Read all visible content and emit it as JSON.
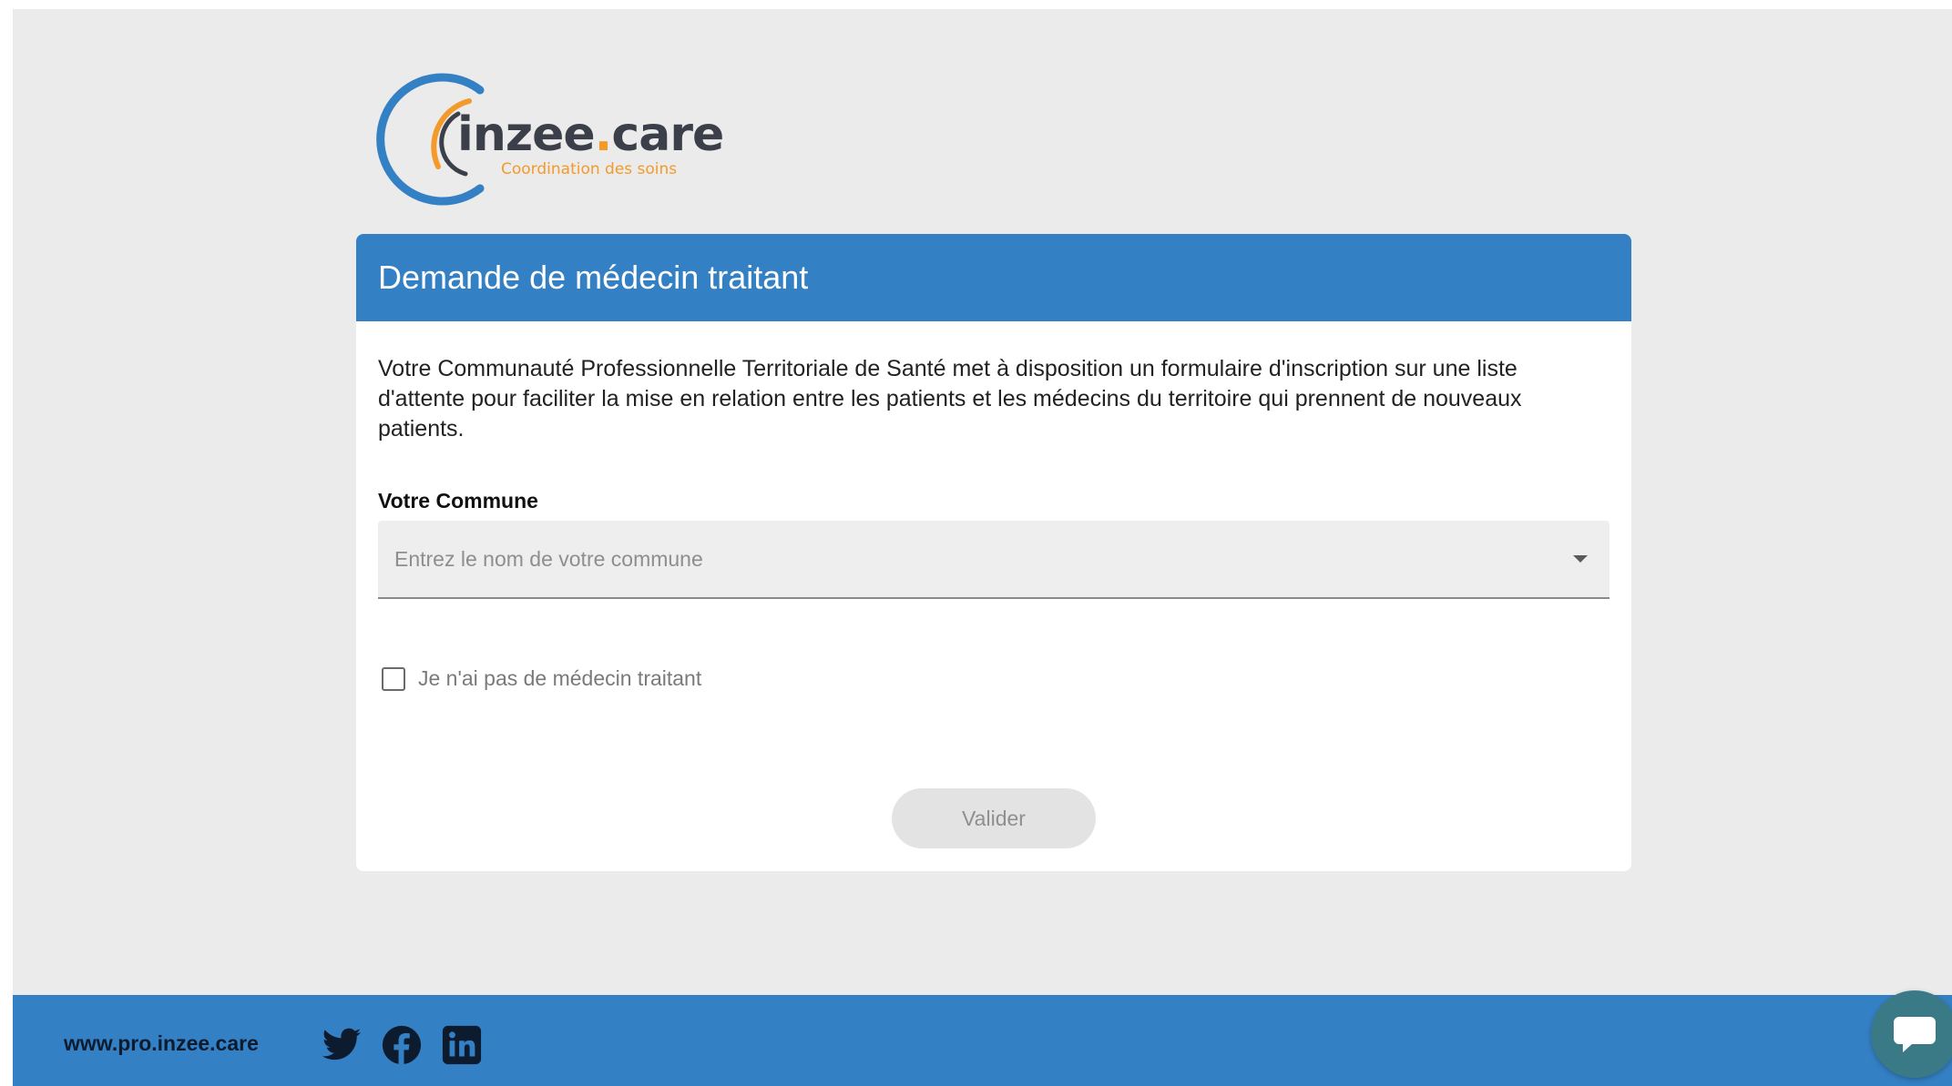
{
  "brand": {
    "name_main": "inzee",
    "name_dot": ".",
    "name_tld": "care",
    "tagline": "Coordination des soins",
    "colors": {
      "primary": "#3480c5",
      "accent": "#f39a2a",
      "dark": "#3b3f4a"
    }
  },
  "card": {
    "title": "Demande de médecin traitant",
    "intro": "Votre Communauté Professionnelle Territoriale de Santé met à disposition un formulaire d'inscription sur une liste d'attente pour faciliter la mise en relation entre les patients et les médecins du territoire qui prennent de nouveaux patients.",
    "commune_label": "Votre Commune",
    "commune_placeholder": "Entrez le nom de votre commune",
    "checkbox_label": "Je n'ai pas de médecin traitant",
    "checkbox_checked": false,
    "submit_label": "Valider"
  },
  "footer": {
    "link_text": "www.pro.inzee.care",
    "socials": [
      "twitter-icon",
      "facebook-icon",
      "linkedin-icon"
    ]
  },
  "chat": {
    "icon": "chat-bubble-icon"
  }
}
